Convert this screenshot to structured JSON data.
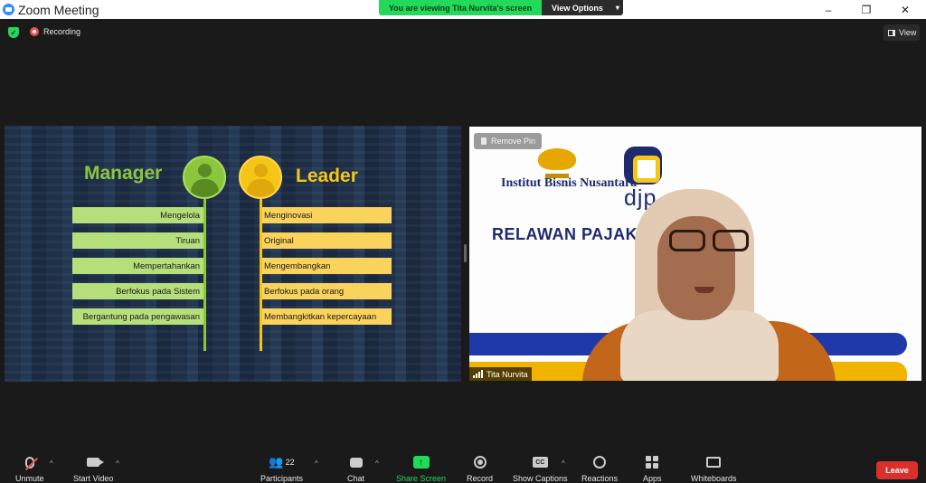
{
  "window": {
    "title": "Zoom Meeting",
    "controls": {
      "minimize": "–",
      "restore": "❐",
      "close": "✕"
    }
  },
  "share_banner": {
    "viewing_text": "You are viewing Tita Nurvita's screen",
    "view_options_label": "View Options"
  },
  "meeting_bar": {
    "recording_label": "Recording",
    "view_label": "View"
  },
  "slide": {
    "manager_title": "Manager",
    "leader_title": "Leader",
    "manager_items": [
      "Mengelola",
      "Tiruan",
      "Mempertahankan",
      "Berfokus pada Sistem",
      "Bergantung pada pengawasan"
    ],
    "leader_items": [
      "Menginovasi",
      "Original",
      "Mengembangkan",
      "Berfokus pada orang",
      "Membangkitkan kepercayaan"
    ]
  },
  "speaker": {
    "remove_pin_label": "Remove Pin",
    "institution": "Institut Bisnis Nusantara",
    "partner_logo_text": "djp",
    "banner_text": "RELAWAN PAJAK 2023",
    "name": "Tita Nurvita"
  },
  "toolbar": {
    "unmute": "Unmute",
    "start_video": "Start Video",
    "participants": "Participants",
    "participants_count": "22",
    "chat": "Chat",
    "share_screen": "Share Screen",
    "record": "Record",
    "show_captions": "Show Captions",
    "reactions": "Reactions",
    "apps": "Apps",
    "whiteboards": "Whiteboards",
    "leave": "Leave",
    "cc_glyph": "CC",
    "caret": "^"
  },
  "colors": {
    "share_green": "#23d959",
    "manager_green": "#8cc63f",
    "leader_yellow": "#f5c518",
    "leave_red": "#d9302b"
  }
}
